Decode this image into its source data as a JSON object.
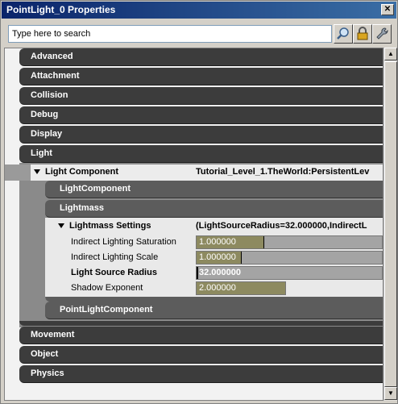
{
  "window": {
    "title": "PointLight_0 Properties"
  },
  "search": {
    "placeholder": "Type here to search",
    "value": "Type here to search"
  },
  "toolbar": {
    "icons": [
      "magnifier-icon",
      "lock-icon",
      "wrench-icon"
    ]
  },
  "categories_top": [
    "Advanced",
    "Attachment",
    "Collision",
    "Debug",
    "Display",
    "Light"
  ],
  "light_component": {
    "label": "Light Component",
    "value": "Tutorial_Level_1.TheWorld:PersistentLev"
  },
  "sub_categories": {
    "first": "LightComponent",
    "second": "Lightmass",
    "last": "PointLightComponent"
  },
  "lightmass_settings": {
    "label": "Lightmass Settings",
    "value": "(LightSourceRadius=32.000000,IndirectL"
  },
  "properties": [
    {
      "label": "Indirect Lighting Saturation",
      "value": "1.000000",
      "fill": 0.18
    },
    {
      "label": "Indirect Lighting Scale",
      "value": "1.000000",
      "fill": 0.18
    },
    {
      "label": "Light Source Radius",
      "value": "32.000000",
      "fill": 0.0
    },
    {
      "label": "Shadow Exponent",
      "value": "2.000000",
      "fill": 0.49
    }
  ],
  "categories_bottom": [
    "Movement",
    "Object",
    "Physics"
  ],
  "colors": {
    "category_bg": "#3c3c3c",
    "subcategory_bg": "#5c5c5c",
    "value_fill": "#8d8a60",
    "titlebar": "#0a246a"
  }
}
